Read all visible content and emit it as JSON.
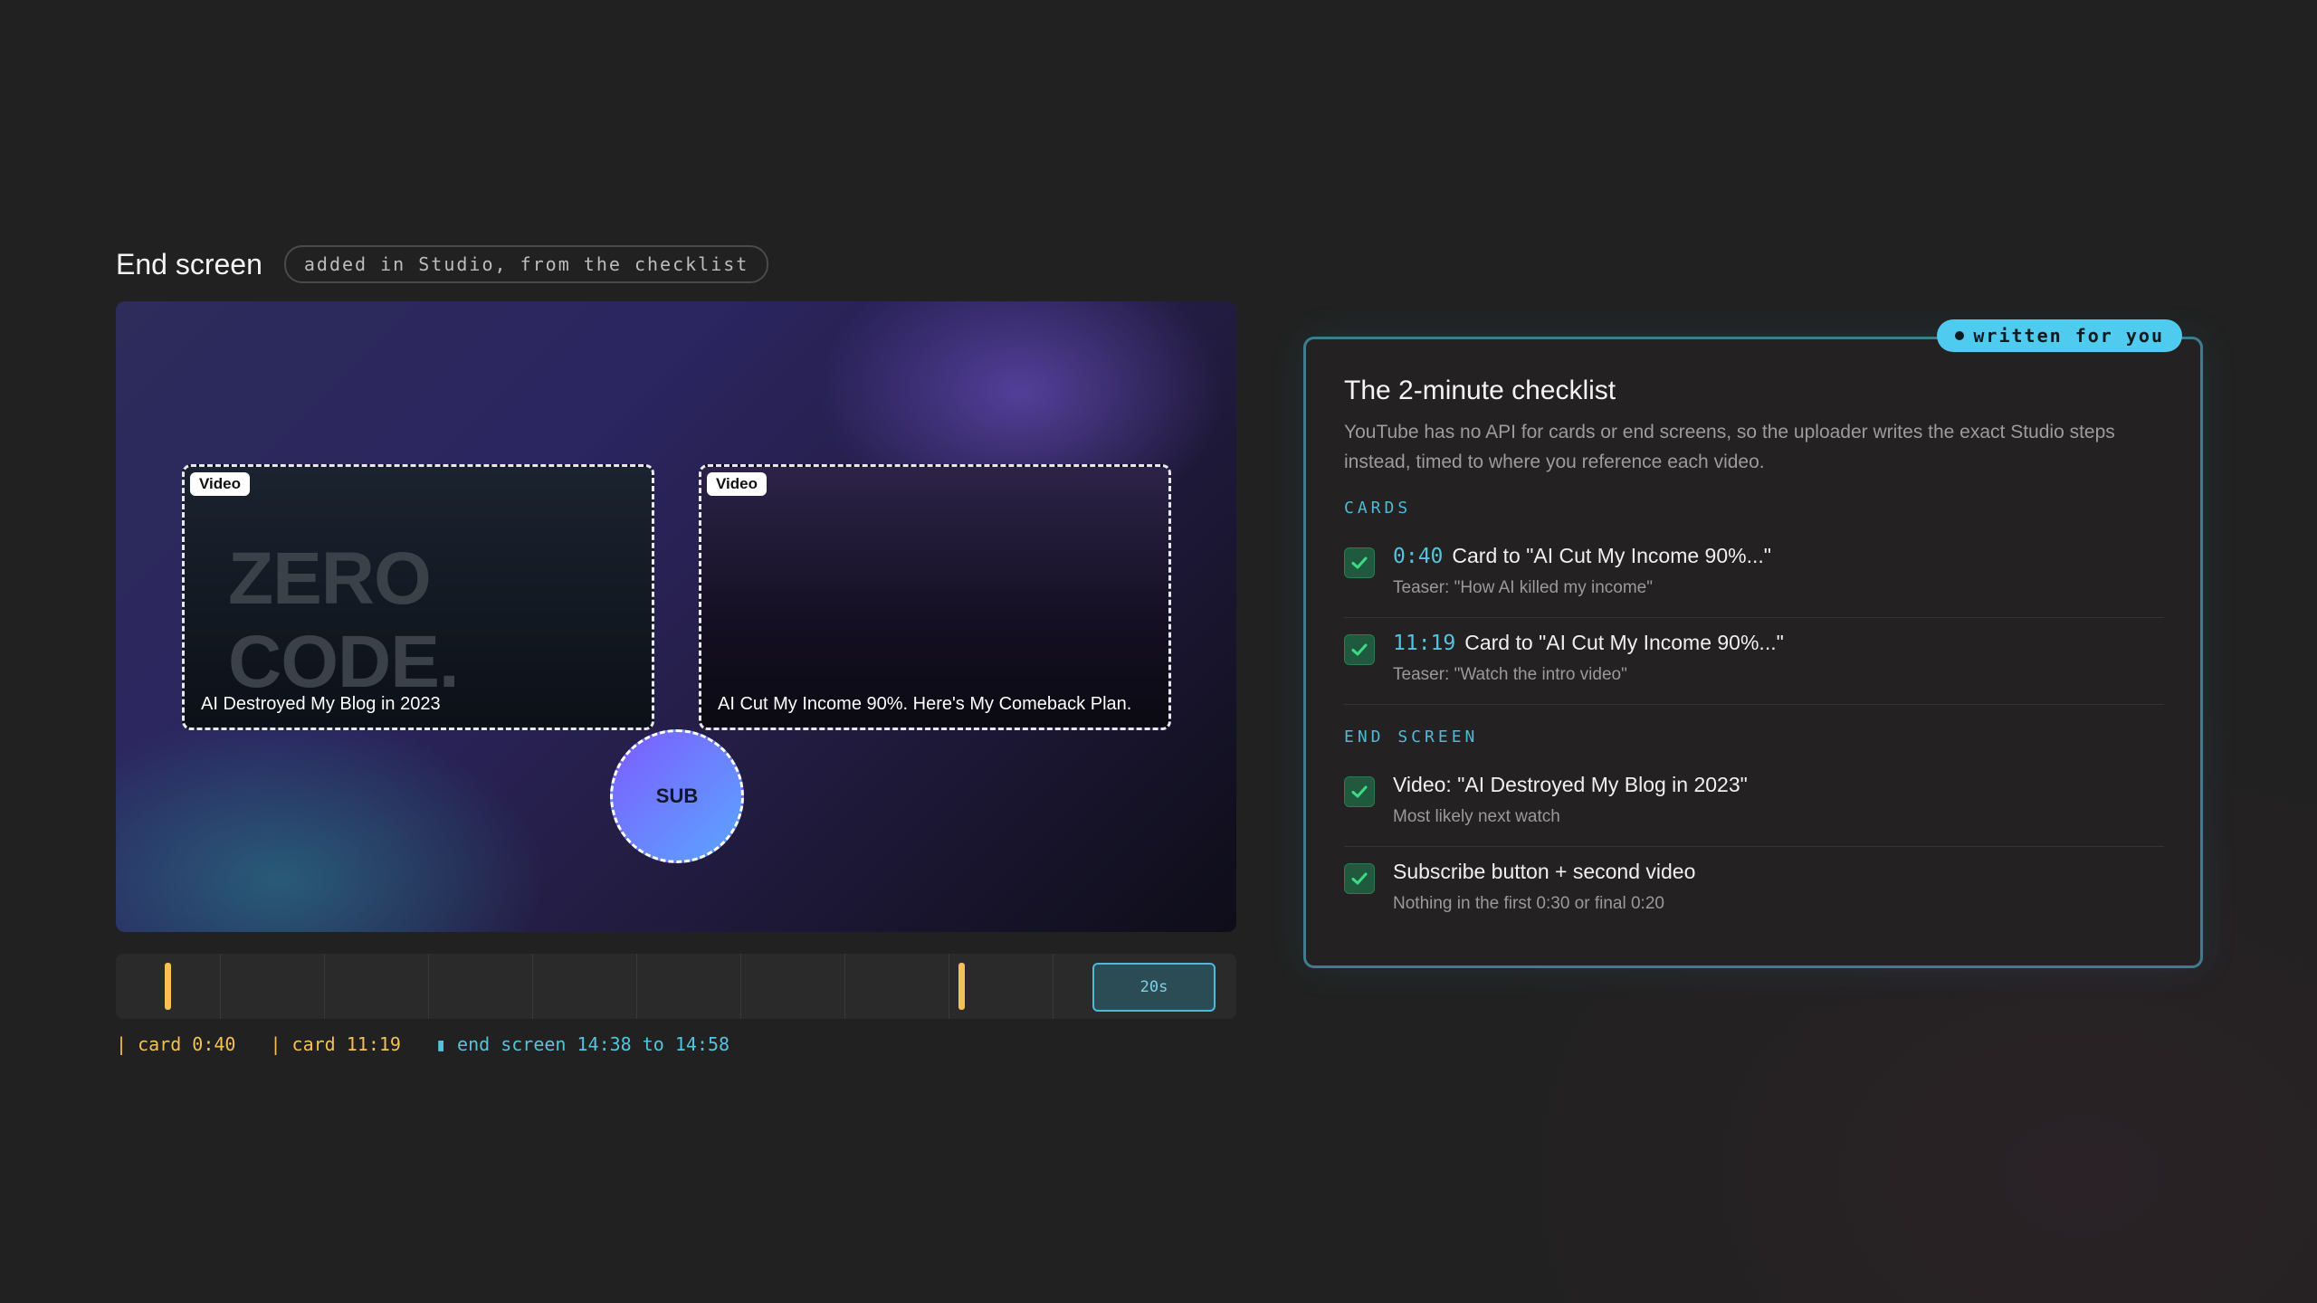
{
  "end_screen": {
    "title": "End screen",
    "pill": "added in Studio, from the checklist",
    "cards": [
      {
        "tag": "Video",
        "thumb_line1": "ZERO",
        "thumb_line2": "CODE.",
        "title": "AI Destroyed My Blog in 2023"
      },
      {
        "tag": "Video",
        "title": "AI Cut My Income 90%. Here's My Comeback Plan."
      }
    ],
    "subscribe_label": "SUB"
  },
  "timeline": {
    "card_marks_seconds": [
      40,
      679
    ],
    "end_screen_block_label": "20s",
    "legend": {
      "card1": "| card 0:40",
      "card2": "| card 11:19",
      "end_screen": "▮ end screen 14:38 to 14:58"
    }
  },
  "checklist": {
    "badge": "written for you",
    "title": "The 2-minute checklist",
    "description": "YouTube has no API for cards or end screens, so the uploader writes the exact Studio steps instead, timed to where you reference each video.",
    "cards_label": "CARDS",
    "cards": [
      {
        "time": "0:40",
        "text": "Card to \"AI Cut My Income 90%...\"",
        "sub": "Teaser: \"How AI killed my income\"",
        "checked": true
      },
      {
        "time": "11:19",
        "text": "Card to \"AI Cut My Income 90%...\"",
        "sub": "Teaser: \"Watch the intro video\"",
        "checked": true
      }
    ],
    "end_screen_label": "END SCREEN",
    "end_screen_items": [
      {
        "text": "Video: \"AI Destroyed My Blog in 2023\"",
        "sub": "Most likely next watch",
        "checked": true
      },
      {
        "text": "Subscribe button + second video",
        "sub": "Nothing in the first 0:30 or final 0:20",
        "checked": true
      }
    ]
  },
  "colors": {
    "accent_cyan": "#4ecbef",
    "marker_yellow": "#f5c056",
    "check_green": "#3ddc84"
  }
}
